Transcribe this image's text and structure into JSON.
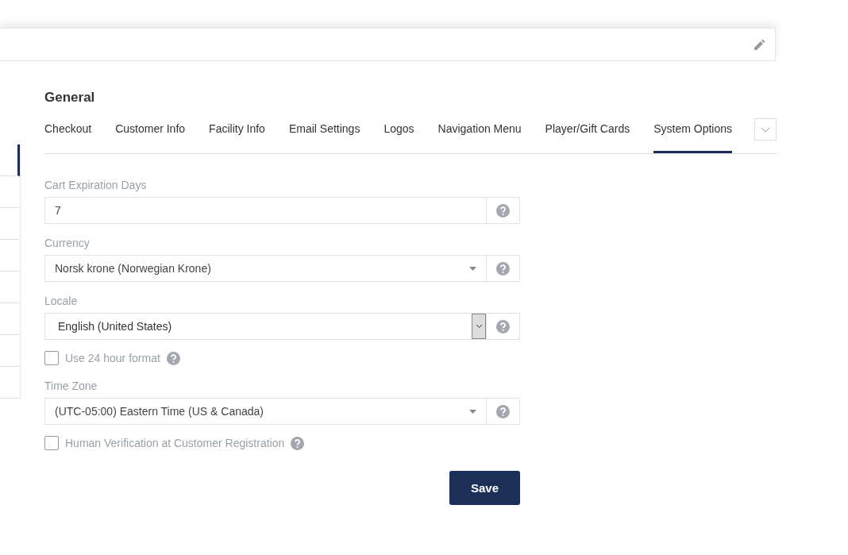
{
  "sidebar": {
    "items": [
      {
        "selected": true
      },
      {
        "selected": false
      },
      {
        "selected": false
      },
      {
        "selected": false
      },
      {
        "selected": false
      },
      {
        "selected": false
      },
      {
        "selected": false
      },
      {
        "selected": false
      }
    ]
  },
  "section": {
    "title": "General"
  },
  "tabs": [
    {
      "label": "Checkout",
      "selected": false
    },
    {
      "label": "Customer Info",
      "selected": false
    },
    {
      "label": "Facility Info",
      "selected": false
    },
    {
      "label": "Email Settings",
      "selected": false
    },
    {
      "label": "Logos",
      "selected": false
    },
    {
      "label": "Navigation Menu",
      "selected": false
    },
    {
      "label": "Player/Gift Cards",
      "selected": false
    },
    {
      "label": "System Options",
      "selected": true
    }
  ],
  "fields": [
    {
      "kind": "text",
      "label": "Cart Expiration Days",
      "value": "7"
    },
    {
      "kind": "select",
      "label": "Currency",
      "value": "Norsk krone (Norwegian Krone)"
    },
    {
      "kind": "native-select",
      "label": "Locale",
      "value": "English (United States)"
    },
    {
      "kind": "checkbox",
      "label": "Use 24 hour format",
      "checked": false
    },
    {
      "kind": "select",
      "label": "Time Zone",
      "value": "(UTC-05:00) Eastern Time (US & Canada)"
    },
    {
      "kind": "checkbox",
      "label": "Human Verification at Customer Registration",
      "checked": false
    }
  ],
  "save_button": "Save"
}
